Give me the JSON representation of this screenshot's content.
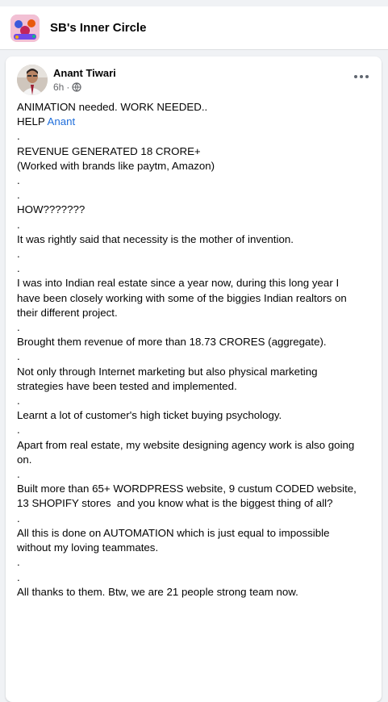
{
  "group": {
    "title": "SB's Inner Circle"
  },
  "post": {
    "author": "Anant Tiwari",
    "time": "6h",
    "separator": "·",
    "lines": [
      "ANIMATION needed. WORK NEEDED..",
      "HELP ",
      ".",
      "REVENUE GENERATED 18 CRORE+",
      "(Worked with brands like paytm, Amazon)",
      ".",
      ".",
      "HOW???????",
      ".",
      "It was rightly said that necessity is the mother of invention.",
      ".",
      ".",
      "I was into Indian real estate since a year now, during this long year I have been closely working with some of the biggies Indian realtors on their different project.",
      ".",
      "Brought them revenue of more than 18.73 CRORES (aggregate).",
      ".",
      "Not only through Internet marketing but also physical marketing strategies have been tested and implemented.",
      ".",
      "Learnt a lot of customer's high ticket buying psychology.",
      ".",
      "Apart from real estate, my website designing agency work is also going on.",
      ".",
      "Built more than 65+ WORDPRESS website, 9 custum CODED website, 13 SHOPIFY stores  and you know what is the biggest thing of all?",
      ".",
      "All this is done on AUTOMATION which is just equal to impossible without my loving teammates.",
      ".",
      ".",
      "All thanks to them. Btw, we are 21 people strong team now."
    ],
    "mention": "Anant"
  },
  "colors": {
    "link": "#216fdb",
    "secondary_text": "#65676b",
    "background": "#f0f2f5"
  },
  "icons": {
    "group": "group-photo-icon",
    "privacy": "globe-icon",
    "more": "more-options-icon"
  }
}
